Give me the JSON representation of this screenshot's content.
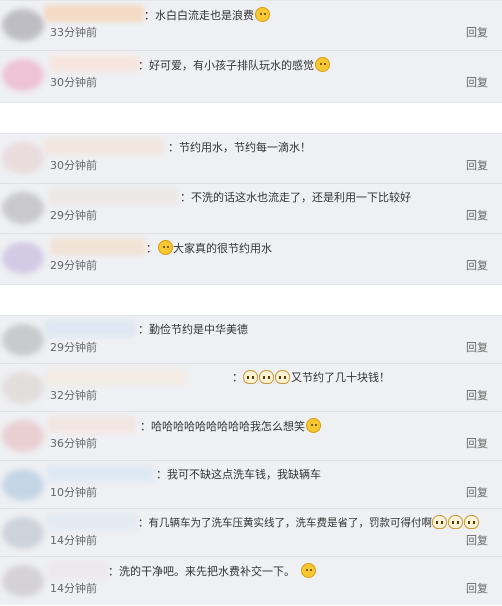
{
  "groups": [
    {
      "comments": [
        {
          "text": "：水白白流走也是浪费",
          "time": "33分钟前",
          "reply": "回复",
          "emoji": "sleepy-face-icon"
        },
        {
          "text": "：好可爱，有小孩子排队玩水的感觉",
          "time": "30分钟前",
          "reply": "回复",
          "emoji": "laughing-face-icon"
        }
      ]
    },
    {
      "comments": [
        {
          "text": "：节约用水，节约每一滴水！",
          "time": "30分钟前",
          "reply": "回复"
        },
        {
          "text": "：不洗的话这水也流走了，还是利用一下比较好",
          "time": "29分钟前",
          "reply": "回复"
        },
        {
          "text_before": "：",
          "text": "大家真的很节约用水",
          "time": "29分钟前",
          "reply": "回复",
          "emoji": "sweat-face-icon"
        }
      ]
    },
    {
      "comments": [
        {
          "text": "：勤俭节约是中华美德",
          "time": "29分钟前",
          "reply": "回复"
        },
        {
          "text_before": "：",
          "text": "又节约了几十块钱！",
          "time": "32分钟前",
          "reply": "回复",
          "emoji": "cat-face-icon"
        },
        {
          "text": "：哈哈哈哈哈哈哈哈哈我怎么想笑",
          "time": "36分钟前",
          "reply": "回复",
          "emoji": "sweat-face-icon"
        },
        {
          "text": "：我可不缺这点洗车钱，我缺辆车",
          "time": "10分钟前",
          "reply": "回复"
        },
        {
          "text": "：有几辆车为了洗车压黄实线了，洗车费是省了，罚款可得付啊",
          "time": "14分钟前",
          "reply": "回复",
          "emoji": "cat-face-icon"
        },
        {
          "text": "：洗的干净吧。来先把水费补交一下。",
          "time": "14分钟前",
          "reply": "回复",
          "emoji": "smile-face-icon"
        }
      ]
    }
  ]
}
